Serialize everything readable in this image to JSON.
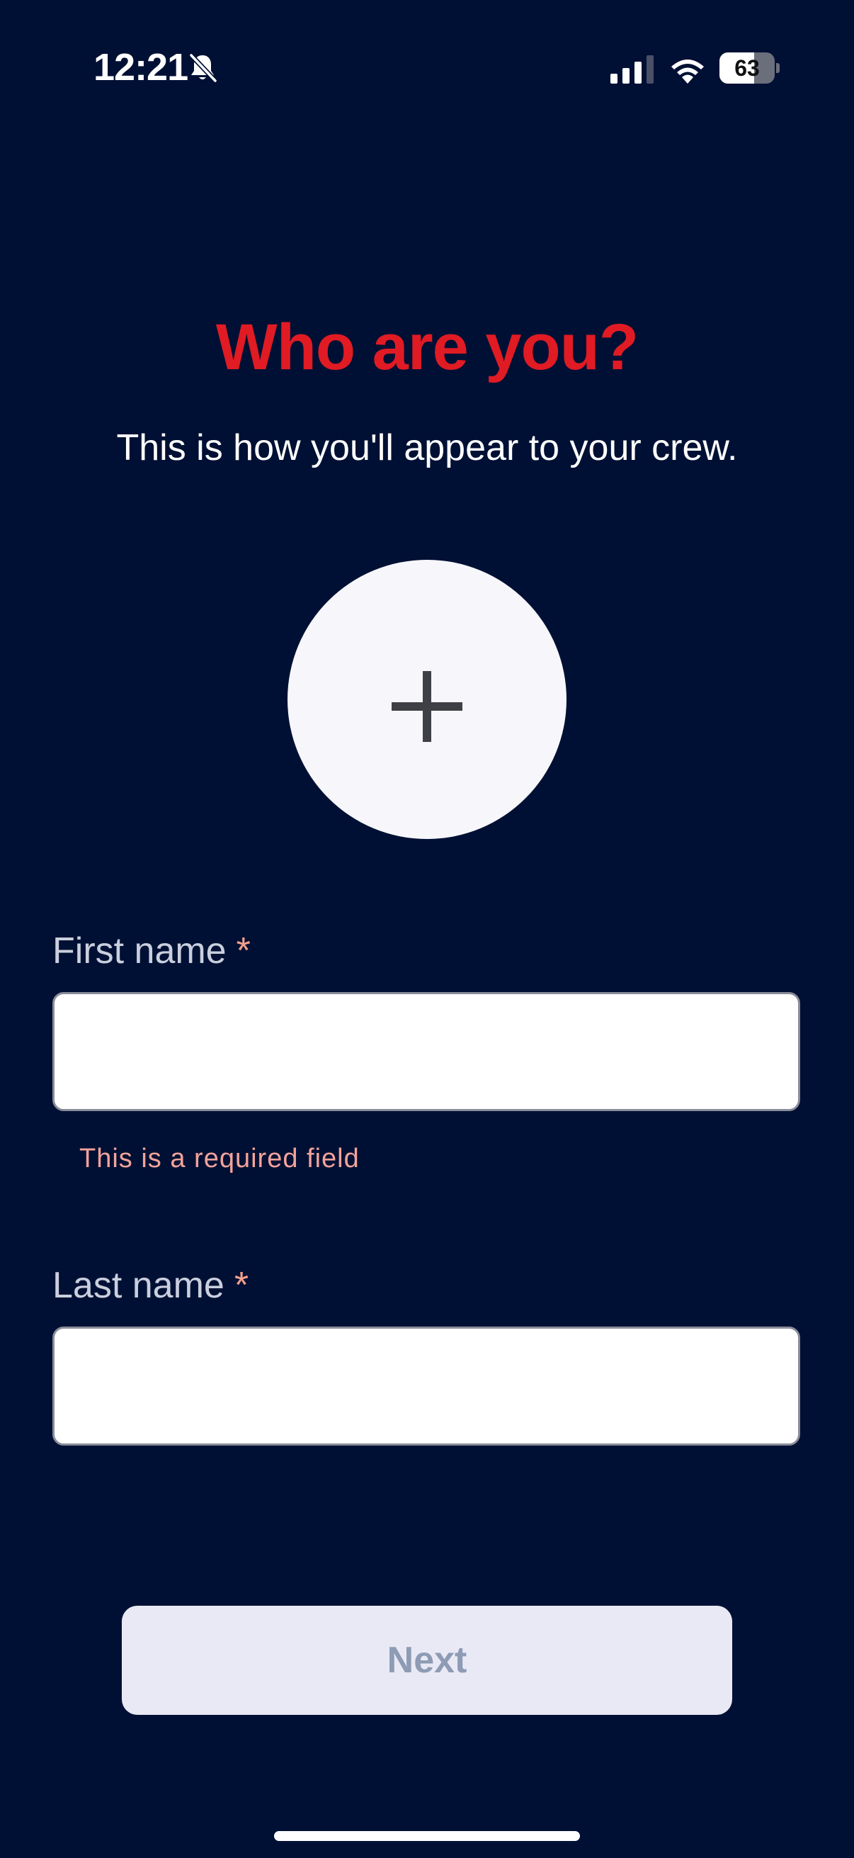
{
  "status_bar": {
    "time": "12:21",
    "battery_level": "63",
    "battery_fraction": 0.63,
    "icons": [
      "bell-slash-icon",
      "cellular-signal-icon",
      "wifi-icon",
      "battery-icon"
    ]
  },
  "header": {
    "title": "Who are you?",
    "subtitle": "This is how you'll appear to your crew."
  },
  "avatar": {
    "icon": "plus-icon"
  },
  "form": {
    "first_name": {
      "label": "First name",
      "required_marker": "*",
      "value": "",
      "error": "This is a required field"
    },
    "last_name": {
      "label": "Last name",
      "required_marker": "*",
      "value": ""
    }
  },
  "actions": {
    "next_label": "Next"
  },
  "colors": {
    "background": "#001034",
    "title": "#e01b24",
    "required_marker": "#f3a08c",
    "error_text": "#f2a39a",
    "button_bg": "#e9e9f5",
    "button_text": "#8e9bb4"
  }
}
